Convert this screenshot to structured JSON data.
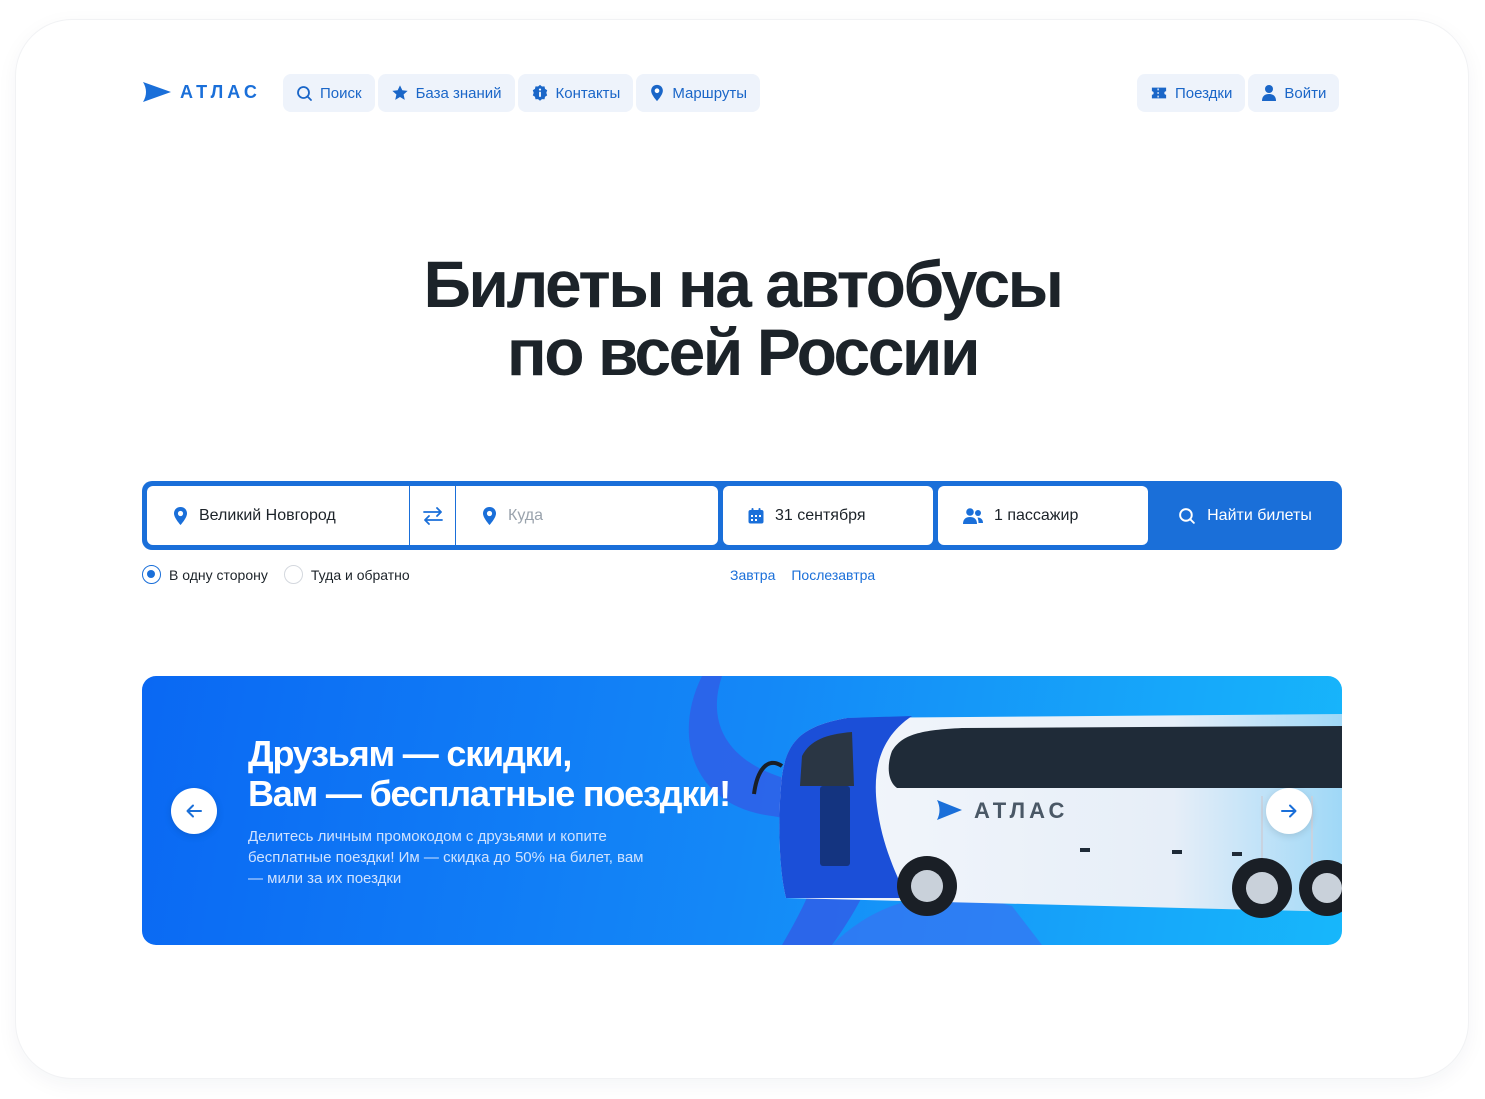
{
  "brand": {
    "name": "АТЛАС"
  },
  "nav": {
    "left": [
      {
        "label": "Поиск",
        "icon": "search-icon"
      },
      {
        "label": "База знаний",
        "icon": "star-icon"
      },
      {
        "label": "Контакты",
        "icon": "info-icon"
      },
      {
        "label": "Маршруты",
        "icon": "map-pin-icon"
      }
    ],
    "right": [
      {
        "label": "Поездки",
        "icon": "ticket-icon"
      },
      {
        "label": "Войти",
        "icon": "user-icon"
      }
    ]
  },
  "hero": {
    "line1": "Билеты на автобусы",
    "line2": "по всей России"
  },
  "search": {
    "from_value": "Великий Новгород",
    "to_placeholder": "Куда",
    "date_value": "31 сентября",
    "passengers_value": "1 пассажир",
    "button_label": "Найти билеты"
  },
  "trip_type": {
    "options": [
      "В одну сторону",
      "Туда и обратно"
    ],
    "selected": "В одну сторону"
  },
  "quick_dates": [
    "Завтра",
    "Послезавтра"
  ],
  "banner": {
    "title_line1": "Друзьям — скидки,",
    "title_line2": "Вам — бесплатные поездки!",
    "text": "Делитесь личным промокодом с друзьями и копите бесплатные поездки! Им — скидка до 50% на билет, вам — мили за их поездки",
    "bus_logo": "АТЛАС"
  },
  "colors": {
    "accent": "#1a6fd9",
    "nav_bg": "#eef3fb",
    "heading": "#1c2329",
    "banner_start": "#0a68f3",
    "banner_end": "#17b7fb"
  }
}
